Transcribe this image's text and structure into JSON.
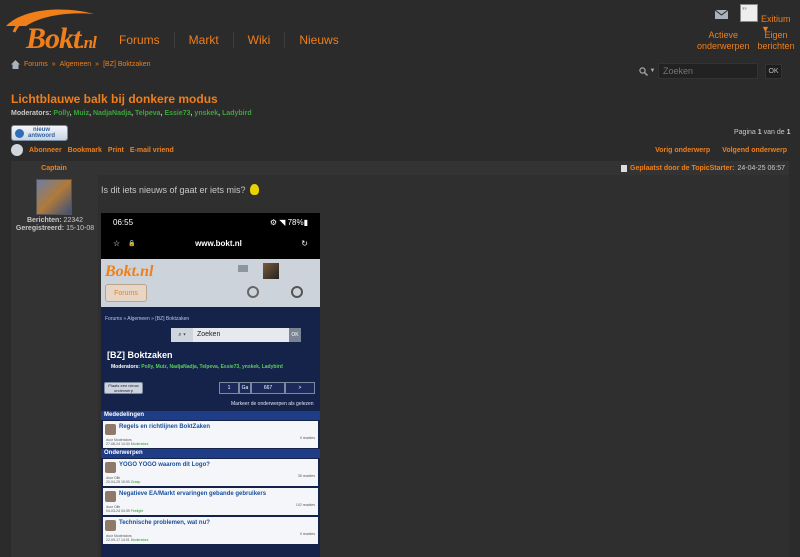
{
  "header": {
    "logo_text": "Bokt",
    "logo_suffix": ".nl",
    "nav": [
      "Forums",
      "Markt",
      "Wiki",
      "Nieuws"
    ],
    "user_name": "Exitium ▼",
    "avatar_text": "??",
    "top_links": [
      {
        "line1": "Actieve",
        "line2": "onderwerpen"
      },
      {
        "line1": "Eigen",
        "line2": "berichten"
      }
    ]
  },
  "breadcrumb": {
    "items": [
      "Forums",
      "»",
      "Algemeen",
      "»",
      "[BZ] Boktzaken"
    ]
  },
  "search": {
    "placeholder": "Zoeken",
    "caret": "▼",
    "ok": "OK"
  },
  "thread": {
    "title": "Lichtblauwe balk bij donkere modus",
    "moderators_label": "Moderators:",
    "moderators": [
      "Polly",
      "Muiz",
      "NadjaNadja",
      "Telpeva",
      "Essie73",
      "ynskek",
      "Ladybird"
    ]
  },
  "reply_button": {
    "line1": "nieuw",
    "line2": "antwoord"
  },
  "pagination": {
    "prefix": "Pagina",
    "current": "1",
    "middle": "van de",
    "total": "1"
  },
  "actions": {
    "left": [
      "Abonneer",
      "Bookmark",
      "Print",
      "E-mail vriend"
    ],
    "right": [
      "Vorig onderwerp",
      "Volgend onderwerp"
    ]
  },
  "post": {
    "author": "Captain",
    "meta_link": "Geplaatst door de TopicStarter:",
    "timestamp": "24-04-25 06:57",
    "stats": {
      "posts_label": "Berichten:",
      "posts": "22342",
      "reg_label": "Geregistreerd:",
      "reg": "15-10-08"
    },
    "text": "Is dit iets nieuws of gaat er iets mis?"
  },
  "screenshot": {
    "time": "06:55",
    "status_right": "⚙ ◥ 78%▮",
    "url": "www.bokt.nl",
    "logo": "Bokt.nl",
    "forums": "Forums",
    "breadcrumb": "Forums » Algemeen » [BZ] Boktzaken",
    "search_placeholder": "Zoeken",
    "search_ok": "OK",
    "title": "[BZ] Boktzaken",
    "mods_label": "Moderators:",
    "mods": "Polly, Muiz, NadjaNadja, Telpeva, Essie73, ynskek, Ladybird",
    "new_topic": {
      "line1": "Plaats een nieuw",
      "line2": "onderwerp"
    },
    "pager": [
      "1",
      "Ga",
      "667",
      ">"
    ],
    "mark_read": "Markeer de onderwerpen als gelezen",
    "sections": [
      "Mededelingen",
      "Onderwerpen"
    ],
    "rows": [
      {
        "title": "Regels en richtlijnen BoktZaken",
        "replies": "0 reacties",
        "by": "door Moderators",
        "date": "27-08-24 14:34",
        "last": "Moderators"
      },
      {
        "title": "YOGO YOGO waarom dit Logo?",
        "replies": "35 reacties",
        "by": "door Olib",
        "date": "20-04-25 15:00",
        "last": "Grasp"
      },
      {
        "title": "Negatieve EA/Markt ervaringen gebande gebruikers",
        "replies": "102 reacties",
        "by": "door Olib",
        "date": "04-03-24 04:39",
        "last": "Firelight"
      },
      {
        "title": "Technische problemen, wat nu?",
        "replies": "0 reacties",
        "by": "door Moderators",
        "date": "22-09-17 14:01",
        "last": "Moderators"
      }
    ]
  }
}
